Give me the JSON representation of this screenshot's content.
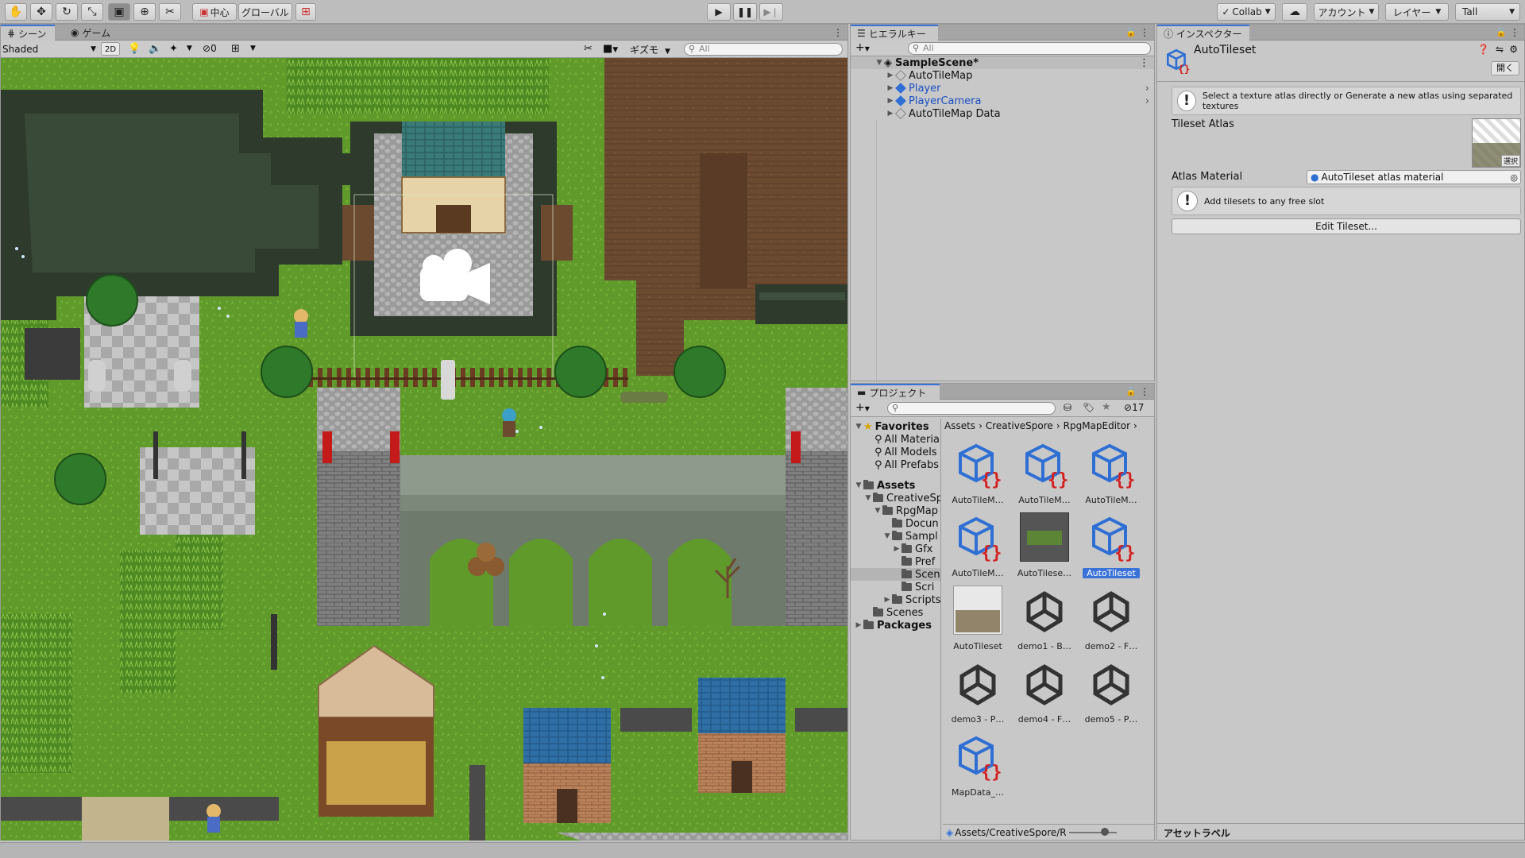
{
  "toolbar": {
    "pivot_label": "中心",
    "space_label": "グローバル",
    "collab_label": "Collab",
    "account_label": "アカウント",
    "layers_label": "レイヤー",
    "layout_label": "Tall"
  },
  "scene_panel": {
    "tabs": [
      "シーン",
      "ゲーム"
    ],
    "shading_mode": "Shaded",
    "mode_2d": "2D",
    "hidden_count": "0",
    "gizmos_label": "ギズモ",
    "search_placeholder": "All"
  },
  "hierarchy": {
    "title": "ヒエラルキー",
    "search_placeholder": "All",
    "scene_name": "SampleScene*",
    "items": [
      {
        "name": "AutoTileMap",
        "prefab": false
      },
      {
        "name": "Player",
        "prefab": true
      },
      {
        "name": "PlayerCamera",
        "prefab": true
      },
      {
        "name": "AutoTileMap Data",
        "prefab": false
      }
    ]
  },
  "project": {
    "title": "プロジェクト",
    "hidden_count": "17",
    "favorites": {
      "label": "Favorites",
      "items": [
        "All Material",
        "All Models",
        "All Prefabs"
      ]
    },
    "assets_label": "Assets",
    "tree": [
      "CreativeSp",
      "RpgMap",
      "Docun",
      "Sampl",
      "Gfx",
      "Pref",
      "Scen",
      "Scri",
      "Scripts",
      "Scenes"
    ],
    "packages_label": "Packages",
    "breadcrumb": [
      "Assets",
      "CreativeSpore",
      "RpgMapEditor"
    ],
    "assets": [
      {
        "label": "AutoTileM…",
        "kind": "script"
      },
      {
        "label": "AutoTileM…",
        "kind": "script"
      },
      {
        "label": "AutoTileM…",
        "kind": "script"
      },
      {
        "label": "AutoTileM…",
        "kind": "script"
      },
      {
        "label": "AutoTilese…",
        "kind": "image-dark"
      },
      {
        "label": "AutoTileset",
        "kind": "script",
        "selected": true
      },
      {
        "label": "AutoTileset",
        "kind": "image"
      },
      {
        "label": "demo1 - B…",
        "kind": "unity"
      },
      {
        "label": "demo2 - F…",
        "kind": "unity"
      },
      {
        "label": "demo3 - P…",
        "kind": "unity"
      },
      {
        "label": "demo4 - F…",
        "kind": "unity"
      },
      {
        "label": "demo5 - P…",
        "kind": "unity"
      },
      {
        "label": "MapData_…",
        "kind": "script"
      }
    ],
    "footer_path": "Assets/CreativeSpore/RpgM"
  },
  "inspector": {
    "title": "インスペクター",
    "object_name": "AutoTileset",
    "open_label": "開く",
    "help1": "Select a texture atlas directly or Generate a new atlas using separated textures",
    "atlas_label": "Tileset Atlas",
    "atlas_select": "選択",
    "material_label": "Atlas Material",
    "material_value": "AutoTileset atlas material",
    "help2": "Add tilesets to any free slot",
    "edit_button": "Edit Tileset...",
    "asset_labels": "アセットラベル"
  },
  "colors": {
    "accent": "#3a72d8",
    "prefab_blue": "#1a4fc4",
    "grass": "#5f9a2a",
    "dirt": "#6b4a30",
    "stone": "#8b8b8b",
    "script_red": "#d22020"
  }
}
